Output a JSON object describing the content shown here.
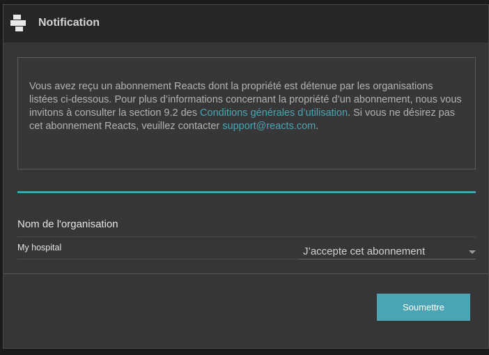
{
  "header": {
    "title": "Notification",
    "logo_icon": "reacts-logo-icon"
  },
  "info": {
    "text_1": "Vous avez reçu un abonnement Reacts dont la propriété est détenue par les organisations listées ci-dessous. Pour plus d’informations concernant la propriété d’un abonnement, nous vous invitons à consulter la section 9.2 des ",
    "terms_link": "Conditions générales d’utilisation",
    "text_2": ". Si vous ne désirez pas cet abonnement Reacts, veuillez contacter ",
    "support_link": "support@reacts.com",
    "text_3": "."
  },
  "table": {
    "column_header": "Nom de l'organisation",
    "rows": [
      {
        "org_name": "My hospital",
        "selected_option": "J’accepte cet abonnement"
      }
    ]
  },
  "footer": {
    "submit_label": "Soumettre"
  },
  "colors": {
    "accent": "#4aa4b3",
    "link": "#49a6b4",
    "background": "#363636",
    "header": "#262626"
  }
}
